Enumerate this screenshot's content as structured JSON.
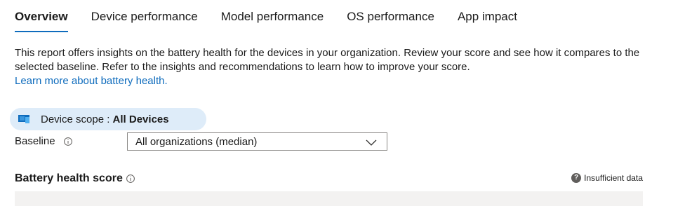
{
  "tabs": [
    {
      "label": "Overview",
      "active": true
    },
    {
      "label": "Device performance",
      "active": false
    },
    {
      "label": "Model performance",
      "active": false
    },
    {
      "label": "OS performance",
      "active": false
    },
    {
      "label": "App impact",
      "active": false
    }
  ],
  "description": {
    "text": "This report offers insights on the battery health for the devices in your organization. Review your score and see how it compares to the selected baseline. Refer to the insights and recommendations to learn how to improve your score.",
    "link_text": "Learn more about battery health."
  },
  "scope": {
    "label": "Device scope : ",
    "value": "All Devices",
    "icon": "monitor-icon"
  },
  "baseline": {
    "label": "Baseline",
    "selected": "All organizations (median)"
  },
  "score": {
    "title": "Battery health score",
    "status": "Insufficient data"
  },
  "colors": {
    "accent": "#0f6cbd",
    "scope_bg": "#deecf9",
    "bar_bg": "#f3f2f1"
  }
}
